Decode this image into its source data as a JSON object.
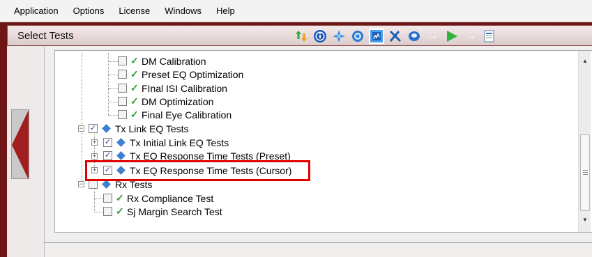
{
  "menu": [
    "Application",
    "Options",
    "License",
    "Windows",
    "Help"
  ],
  "panel": {
    "title": "Select Tests"
  },
  "toolbar_icons": [
    "sort-arrows-icon",
    "info-icon",
    "crosshair-icon",
    "gear-icon",
    "results-icon",
    "tools-icon",
    "disc-icon",
    "arrow-right-icon",
    "run-icon",
    "arrow-right-icon",
    "report-icon"
  ],
  "tree": {
    "dm_calibration": "DM Calibration",
    "preset_eq_opt": "Preset EQ Optimization",
    "final_isi_cal": "FInal ISI Calibration",
    "dm_optimization": "DM Optimization",
    "final_eye_cal": "Final Eye Calibration",
    "tx_link_eq": "Tx Link EQ Tests",
    "tx_initial_link": "Tx Initial Link EQ Tests",
    "tx_eq_preset": "Tx EQ Response Time Tests (Preset)",
    "tx_eq_cursor": "Tx EQ Response Time Tests (Cursor)",
    "rx_tests": "Rx Tests",
    "rx_compliance": "Rx Compliance Test",
    "sj_margin": "Sj Margin Search Test"
  },
  "colors": {
    "frame": "#6e1616",
    "highlight": "#e00000",
    "check": "#2e9a2e",
    "diamond": "#3d7fd0"
  }
}
